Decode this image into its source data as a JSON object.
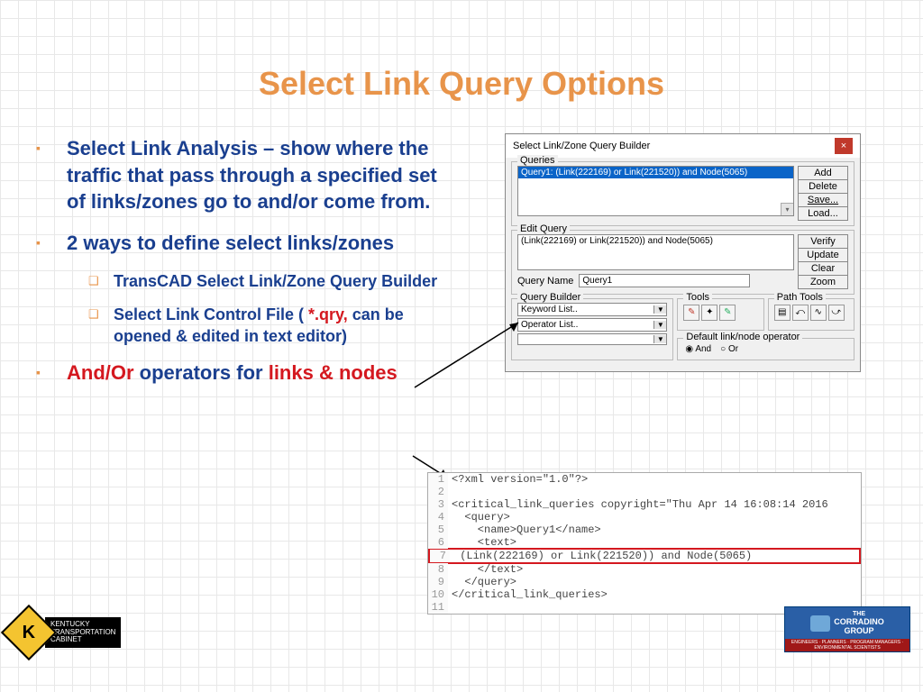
{
  "title": "Select Link Query Options",
  "bullets": {
    "b1": "Select Link Analysis – show where the traffic that pass through a specified set of links/zones go to and/or come from.",
    "b2": "2 ways to define select links/zones",
    "b2a": "TransCAD Select Link/Zone Query Builder",
    "b2b_pre": "Select Link Control File ( ",
    "b2b_red": "*.qry,",
    "b2b_post": " can be opened & edited in text editor)",
    "b3_red1": "And/Or",
    "b3_mid": " operators for ",
    "b3_red2": "links & nodes"
  },
  "dialog": {
    "title": "Select Link/Zone Query Builder",
    "close": "×",
    "queries_label": "Queries",
    "query_selected": "Query1: (Link(222169) or Link(221520)) and Node(5065)",
    "add": "Add",
    "delete": "Delete",
    "save": "Save...",
    "load": "Load...",
    "edit_label": "Edit Query",
    "edit_text": "(Link(222169) or Link(221520)) and Node(5065)",
    "verify": "Verify",
    "update": "Update",
    "clear": "Clear",
    "zoom": "Zoom",
    "qn_label": "Query Name",
    "qn_value": "Query1",
    "qb_label": "Query Builder",
    "kw": "Keyword List..",
    "op": "Operator List..",
    "tools_label": "Tools",
    "pathtools_label": "Path Tools",
    "defop_label": "Default link/node operator",
    "and": "And",
    "or": "Or"
  },
  "xml": {
    "l1": "<?xml version=\"1.0\"?>",
    "l2": "",
    "l3": "<critical_link_queries copyright=\"Thu Apr 14 16:08:14 2016",
    "l4": "  <query>",
    "l5": "    <name>Query1</name>",
    "l6": "    <text>",
    "l7": " (Link(222169) or Link(221520)) and Node(5065)",
    "l8": "    </text>",
    "l9": "  </query>",
    "l10": "</critical_link_queries>",
    "l11": ""
  },
  "logo_left": {
    "k": "K",
    "line1": "KENTUCKY",
    "line2": "TRANSPORTATION",
    "line3": "CABINET"
  },
  "logo_right": {
    "top1": "THE",
    "top2": "CORRADINO",
    "top3": "GROUP",
    "bottom": "ENGINEERS · PLANNERS · PROGRAM MANAGERS · ENVIRONMENTAL SCIENTISTS"
  }
}
